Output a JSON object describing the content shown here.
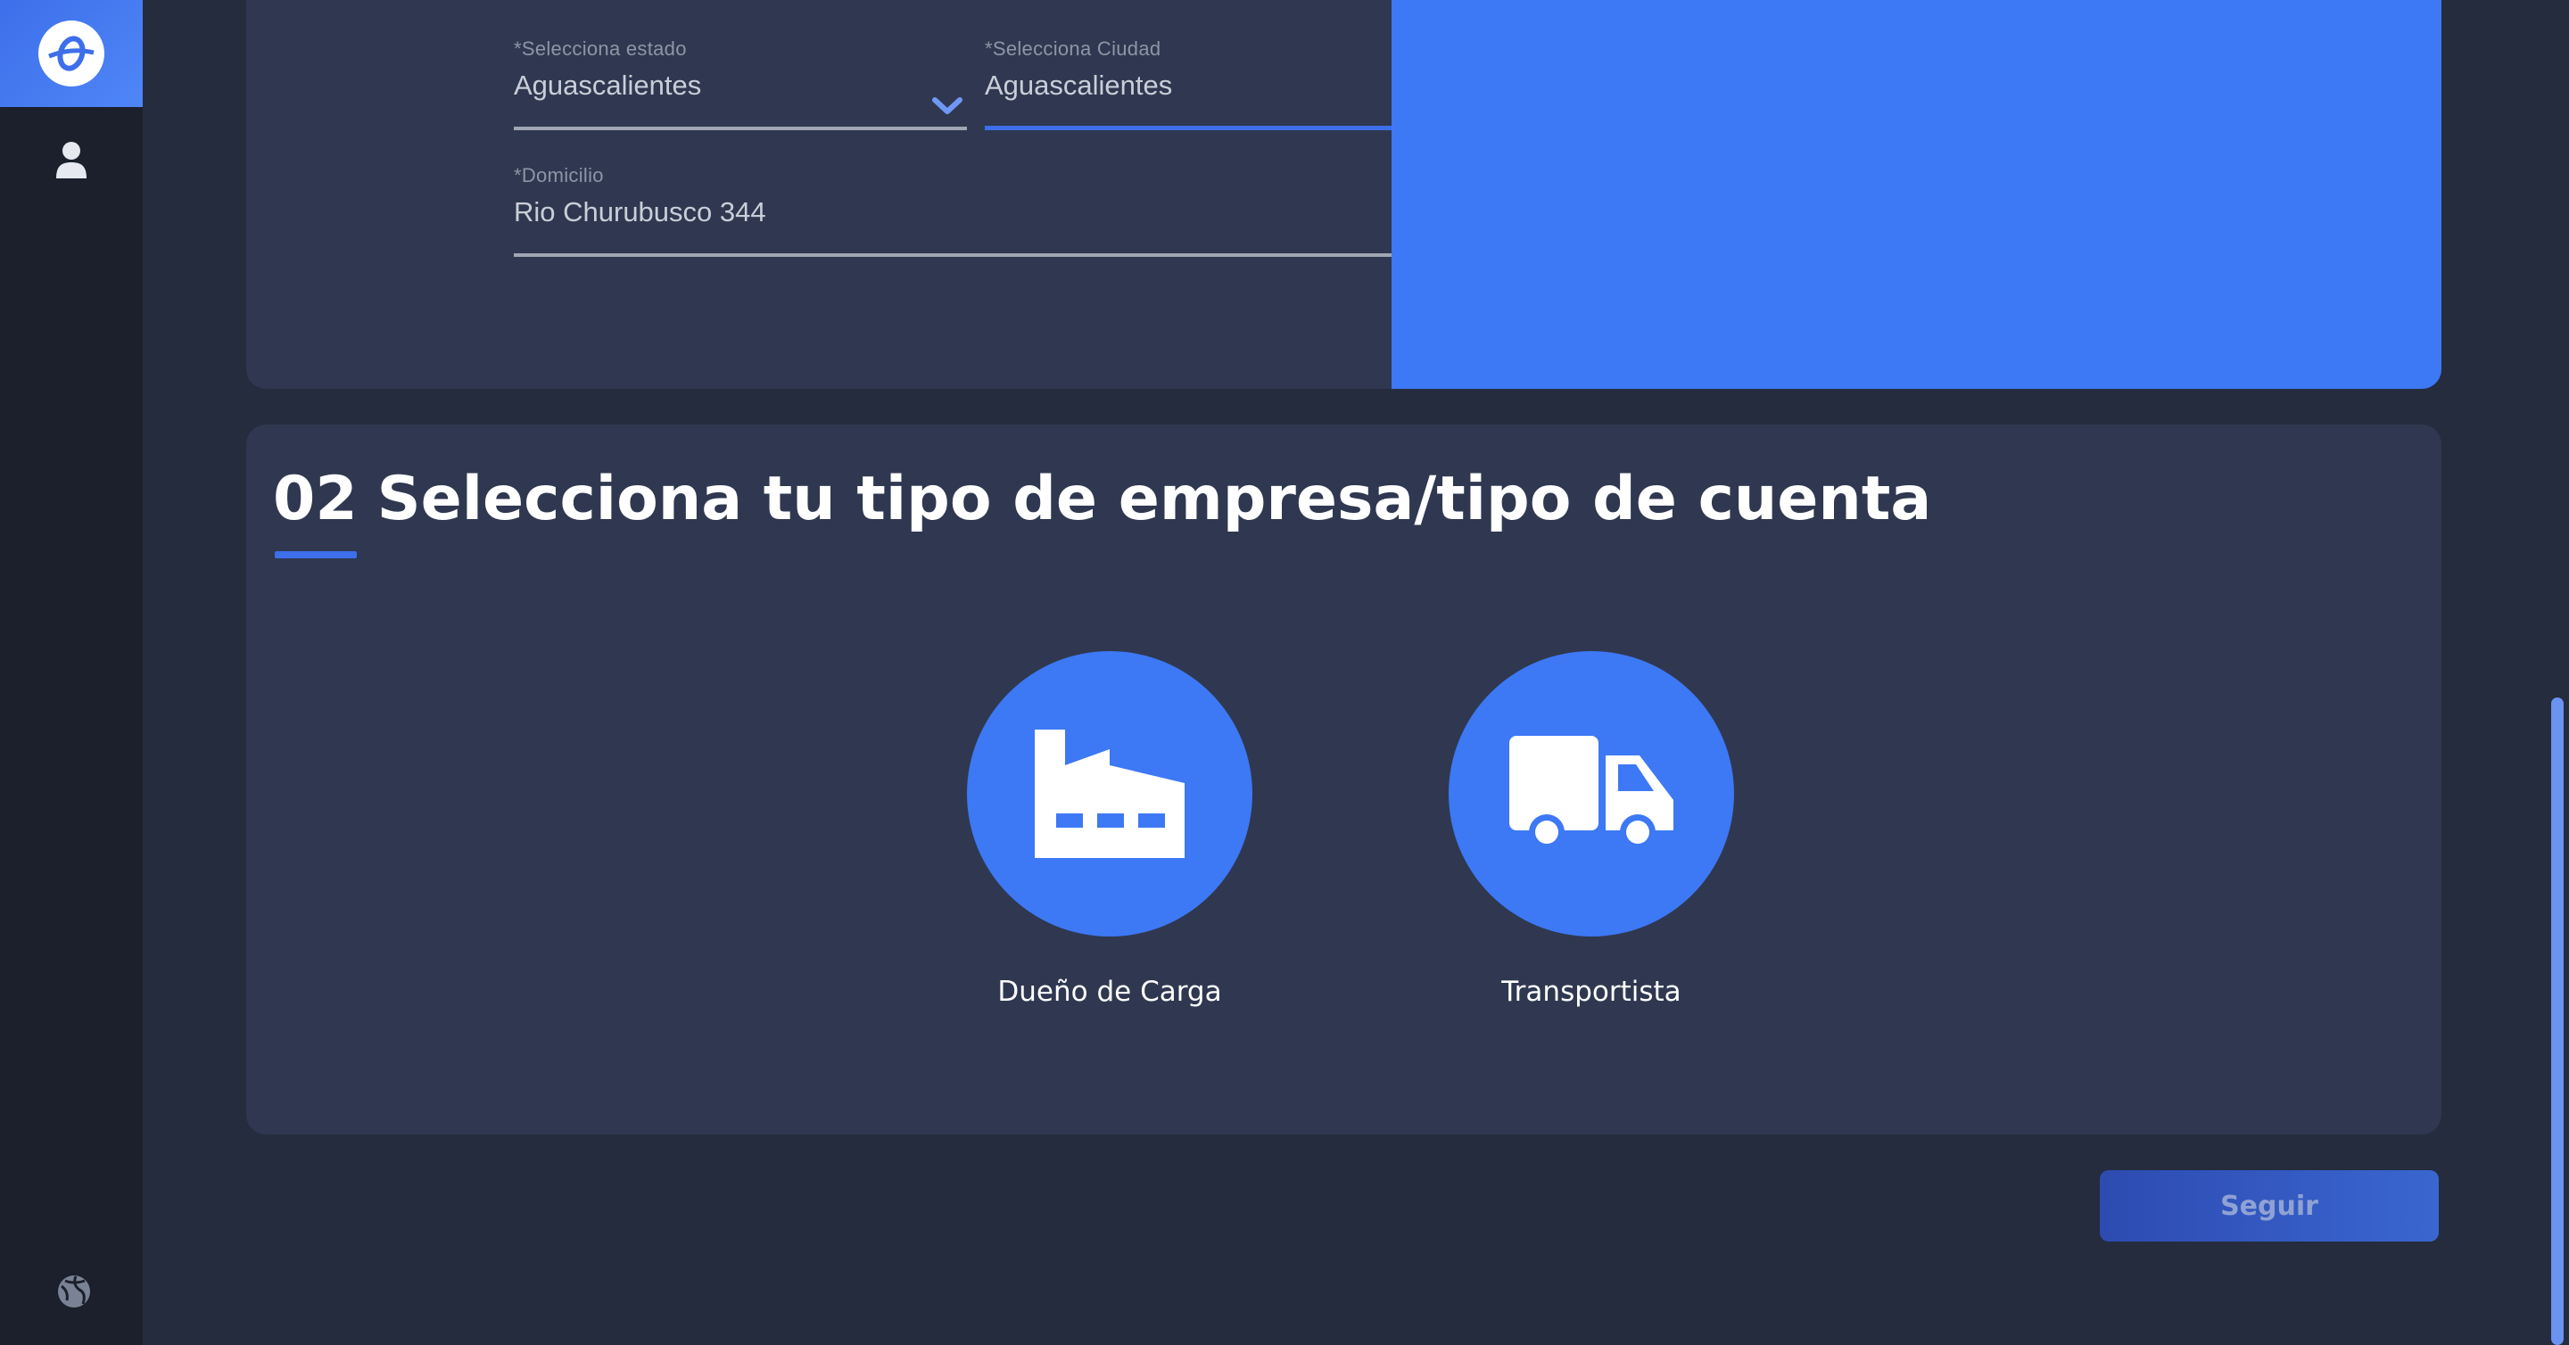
{
  "sidebar": {
    "logo_icon": "orb-logo-icon",
    "items": [
      {
        "icon": "user-icon"
      },
      {
        "icon": "globe-icon"
      }
    ]
  },
  "address": {
    "estado": {
      "label": "*Selecciona estado",
      "value": "Aguascalientes"
    },
    "ciudad": {
      "label": "*Selecciona Ciudad",
      "value": "Aguascalientes"
    },
    "domicilio": {
      "label": "*Domicilio",
      "value": "Rio Churubusco 344"
    }
  },
  "section2": {
    "number": "02",
    "title": "Selecciona tu tipo de empresa/tipo de cuenta",
    "options": [
      {
        "label": "Dueño de Carga",
        "icon": "factory-icon"
      },
      {
        "label": "Transportista",
        "icon": "truck-icon"
      }
    ]
  },
  "actions": {
    "next_label": "Seguir"
  },
  "colors": {
    "accent": "#3d78f5",
    "card": "#2f3850",
    "background": "#242c3d",
    "sidebar": "#1b202c"
  }
}
